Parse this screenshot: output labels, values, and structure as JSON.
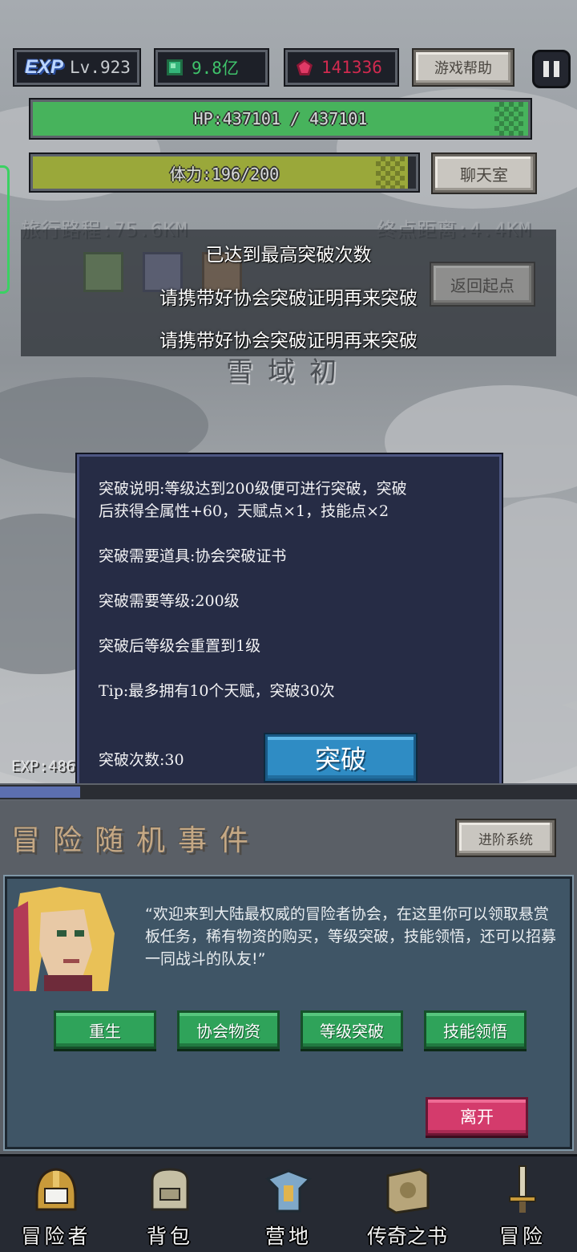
{
  "top_bar": {
    "exp_badge": "EXP",
    "level": "Lv.923",
    "gold": "9.8亿",
    "gems": "141336",
    "help_label": "游戏帮助"
  },
  "hp_bar": {
    "text": "HP:437101 / 437101",
    "fill_percent": 100,
    "color": "#47b35c"
  },
  "stamina_bar": {
    "text": "体力:196/200",
    "fill_percent": 98,
    "color": "#9aa83a"
  },
  "chat_label": "聊天室",
  "route": {
    "traveled": "旅行路程:75.6KM",
    "remaining": "终点距离:4.4KM"
  },
  "toast": {
    "lines": [
      "已达到最高突破次数",
      "请携带好协会突破证明再来突破",
      "请携带好协会突破证明再来突破"
    ],
    "return_label": "返回起点"
  },
  "area_name": "雪域初",
  "dialog": {
    "desc_line1": "突破说明:等级达到200级便可进行突破，突破",
    "desc_line2": "后获得全属性+60，天赋点×1，技能点×2",
    "item_req": "突破需要道具:协会突破证书",
    "level_req": "突破需要等级:200级",
    "reset_note": "突破后等级会重置到1级",
    "tip": "Tip:最多拥有10个天赋，突破30次",
    "count": "突破次数:30",
    "button": "突破"
  },
  "exp_label": "EXP:486",
  "section": {
    "title": "冒险随机事件",
    "advance_label": "进阶系统"
  },
  "npc": {
    "message": "“欢迎来到大陆最权威的冒险者协会，在这里你可以领取悬赏板任务，稀有物资的购买，等级突破，技能领悟，还可以招募一同战斗的队友!”",
    "buttons": [
      "重生",
      "协会物资",
      "等级突破",
      "技能领悟"
    ],
    "leave": "离开"
  },
  "nav": [
    {
      "label": "冒险者",
      "icon": "helmet-icon"
    },
    {
      "label": "背包",
      "icon": "backpack-icon"
    },
    {
      "label": "营地",
      "icon": "camp-icon"
    },
    {
      "label": "传奇之书",
      "icon": "book-icon"
    },
    {
      "label": "冒险",
      "icon": "sword-icon"
    }
  ]
}
